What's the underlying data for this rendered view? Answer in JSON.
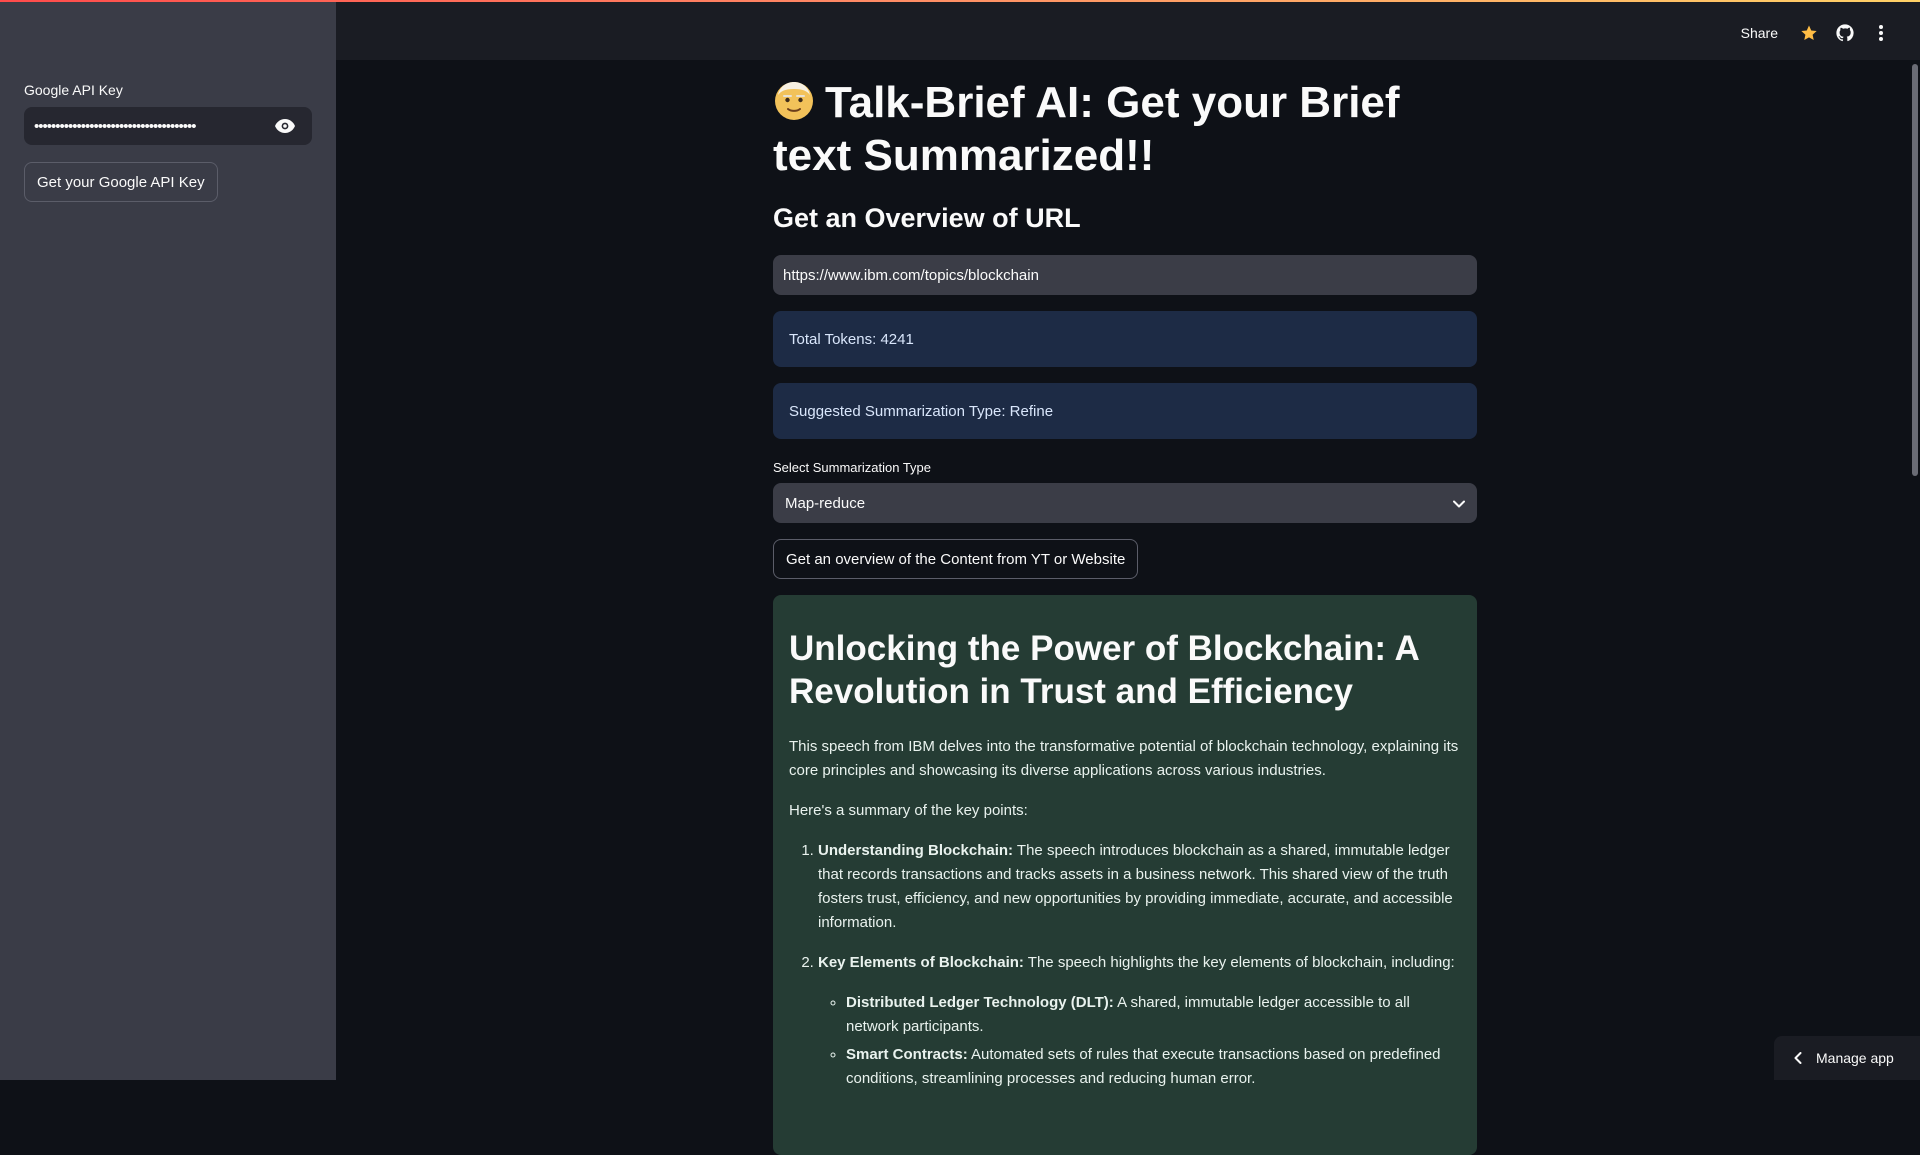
{
  "sidebar": {
    "api_key_label": "Google API Key",
    "api_key_value": "••••••••••••••••••••••••••••••••••••••",
    "get_key_button": "Get your Google API Key"
  },
  "header": {
    "share_label": "Share",
    "icons": [
      "star-icon",
      "github-icon",
      "more-vertical-icon"
    ],
    "star_color": "#ffbd45"
  },
  "main": {
    "title": "Talk-Brief AI: Get your Brief text Summarized!!",
    "title_emoji": "old-man-face-icon",
    "subtitle": "Get an Overview of URL",
    "url_value": "https://www.ibm.com/topics/blockchain",
    "total_tokens": "Total Tokens: 4241",
    "suggested_type": "Suggested Summarization Type: Refine",
    "select_label": "Select Summarization Type",
    "select_value": "Map-reduce",
    "action_button": "Get an overview of the Content from YT or Website"
  },
  "result": {
    "heading": "Unlocking the Power of Blockchain: A Revolution in Trust and Efficiency",
    "intro": "This speech from IBM delves into the transformative potential of blockchain technology, explaining its core principles and showcasing its diverse applications across various industries.",
    "summary_lead": "Here's a summary of the key points:",
    "points": [
      {
        "title": "Understanding Blockchain:",
        "text": " The speech introduces blockchain as a shared, immutable ledger that records transactions and tracks assets in a business network. This shared view of the truth fosters trust, efficiency, and new opportunities by providing immediate, accurate, and accessible information."
      },
      {
        "title": "Key Elements of Blockchain:",
        "text": " The speech highlights the key elements of blockchain, including:",
        "subpoints": [
          {
            "title": "Distributed Ledger Technology (DLT):",
            "text": " A shared, immutable ledger accessible to all network participants."
          },
          {
            "title": "Smart Contracts:",
            "text": " Automated sets of rules that execute transactions based on predefined conditions, streamlining processes and reducing human error."
          }
        ]
      }
    ]
  },
  "footer": {
    "manage_app": "Manage app"
  },
  "colors": {
    "sidebar_bg": "#3a3c47",
    "main_bg": "#0e1117",
    "info_bg": "#1d2b45",
    "success_bg": "#253c34"
  }
}
